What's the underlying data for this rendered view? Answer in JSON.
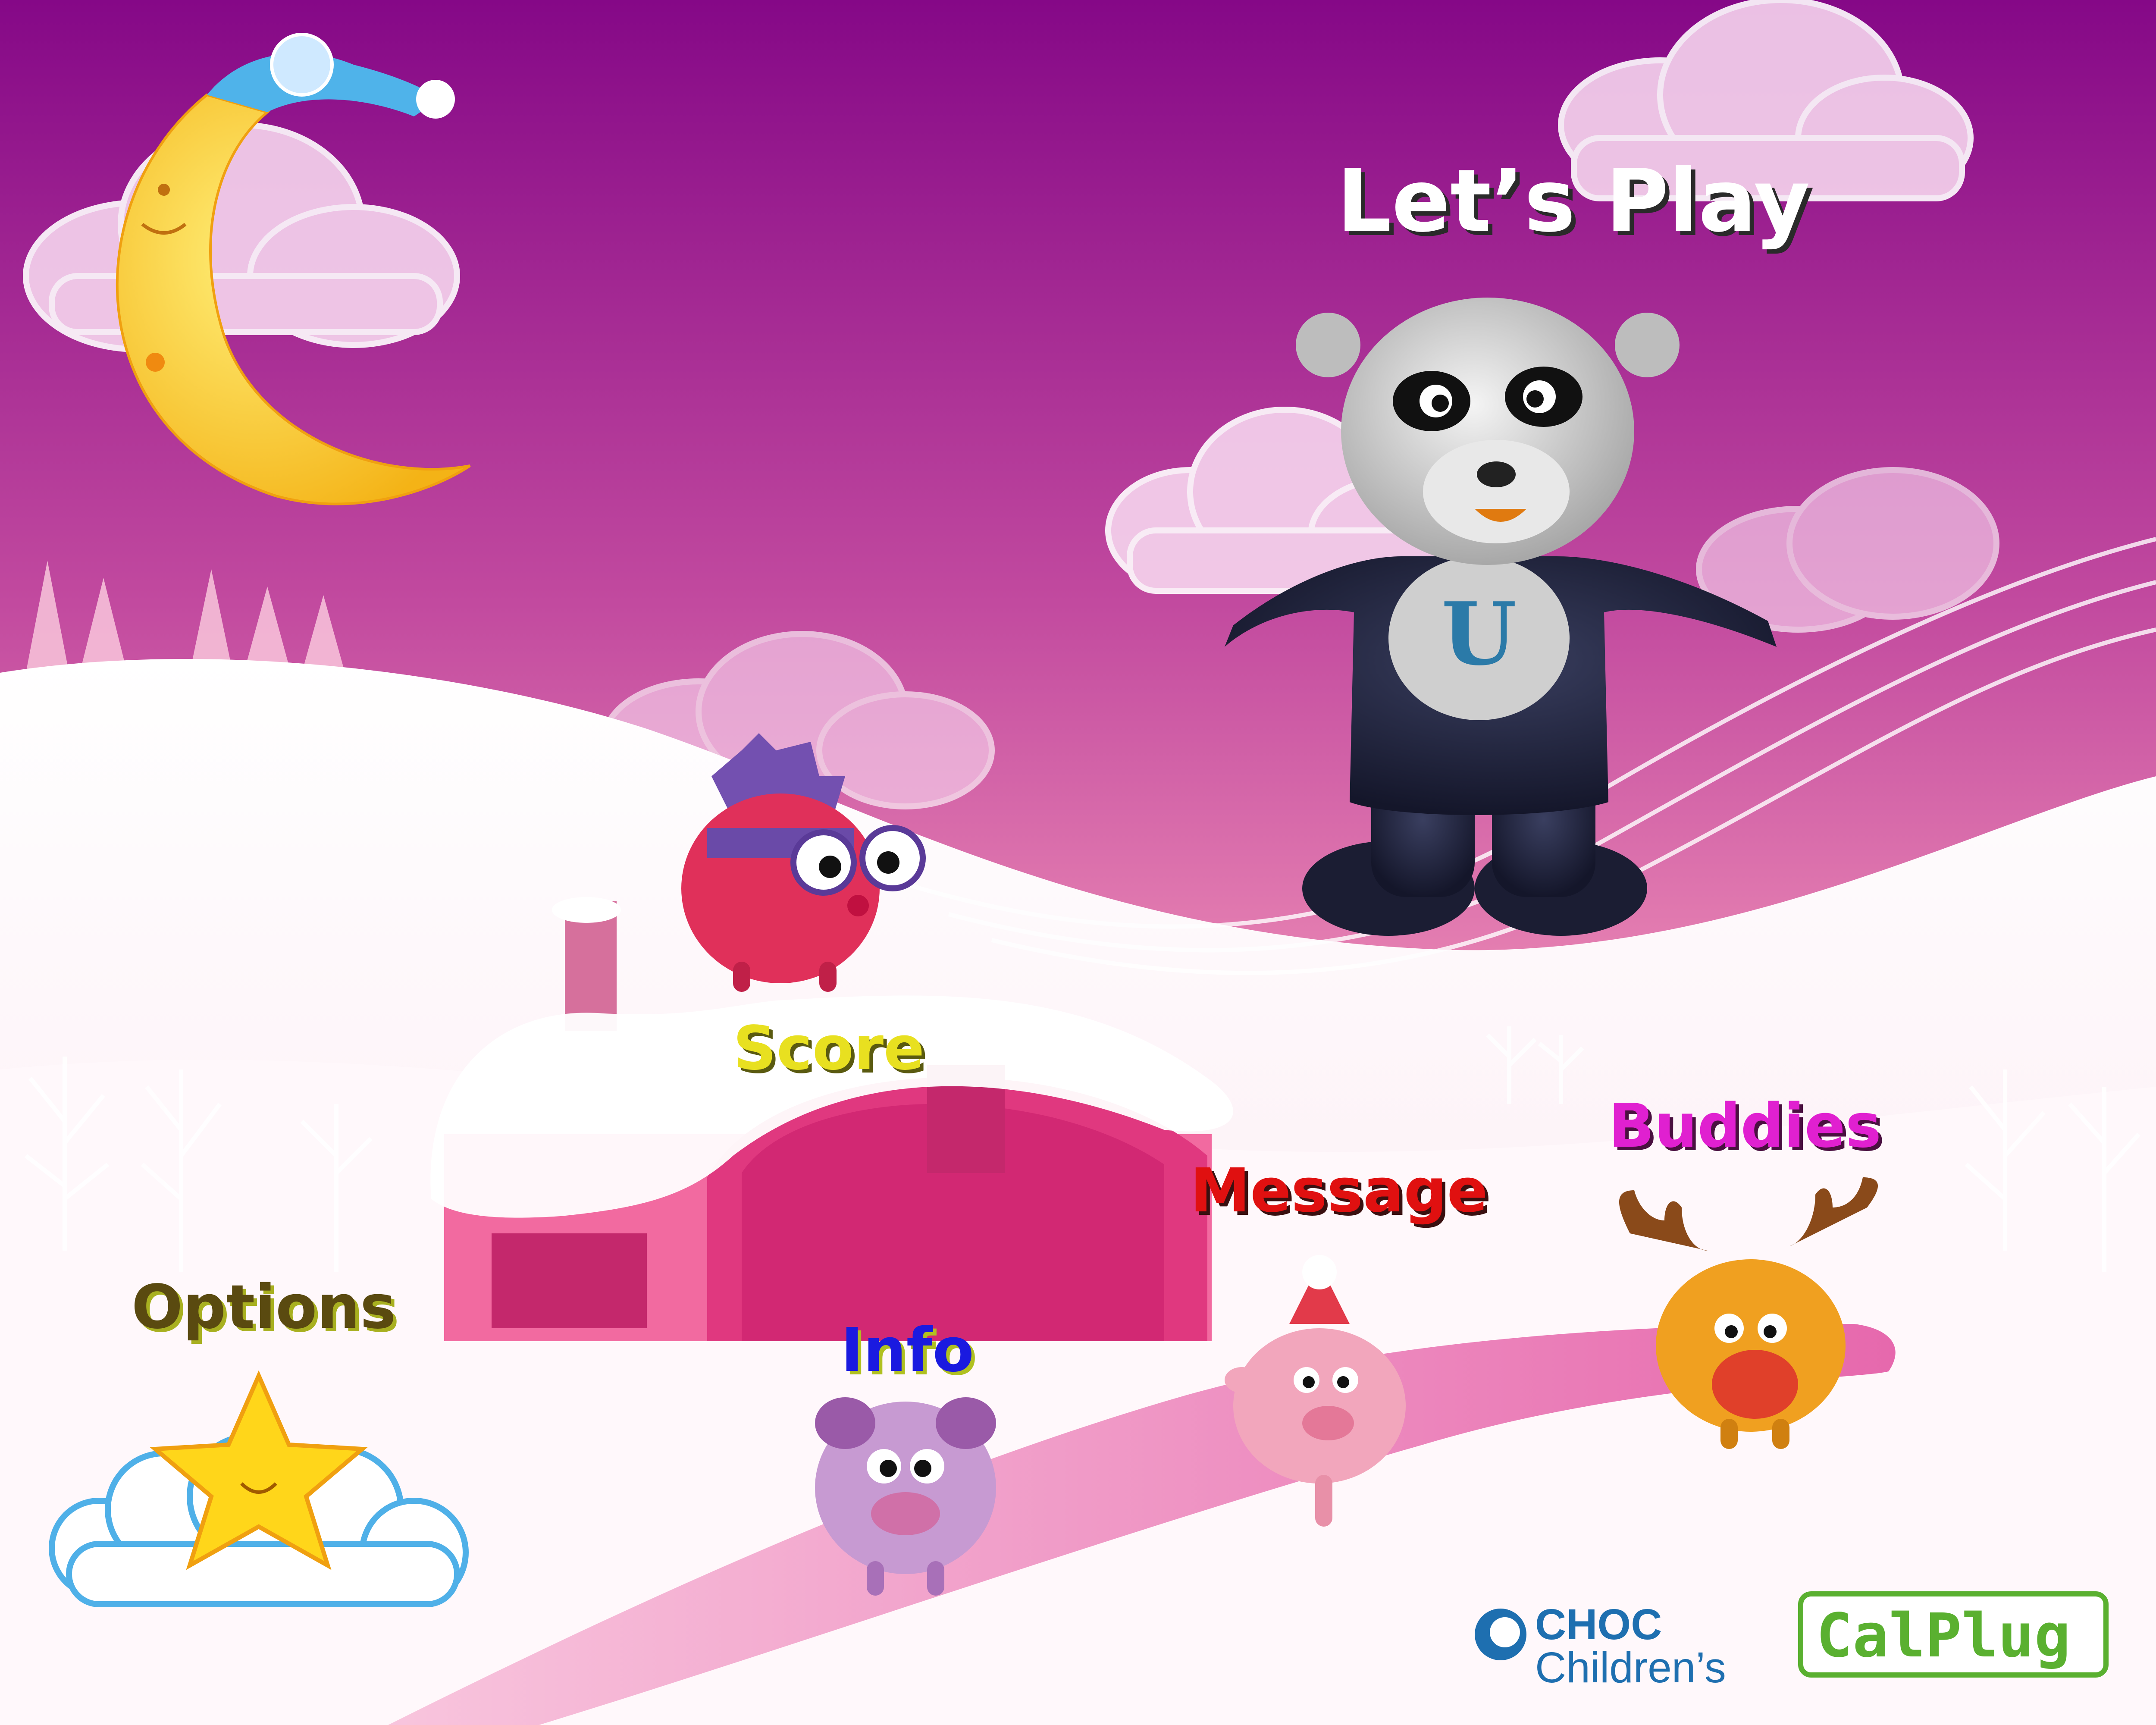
{
  "menu": {
    "lets_play": "Let’s Play",
    "score": "Score",
    "message": "Message",
    "buddies": "Buddies",
    "options": "Options",
    "info": "Info"
  },
  "logos": {
    "choc_top": "CHOC",
    "choc_bottom": "Children’s",
    "calplug": "CalPlug"
  },
  "colors": {
    "sky_top": "#860a8a",
    "sky_bottom": "#f2a0c4",
    "snow": "#fff7fb",
    "lets_play": "#ffffff",
    "score": "#e8e020",
    "message": "#e01010",
    "buddies": "#e020d0",
    "options": "#5a4a10",
    "info": "#1a1ae0",
    "calplug": "#5ab030",
    "choc": "#1e6fb0"
  },
  "icons": {
    "moon": "moon-with-nightcap-icon",
    "star": "star-on-cloud-icon",
    "bear": "panda-bear-mascot",
    "hedgehog": "hedgehog-plush",
    "sheep": "sheep-plush",
    "pig": "pig-plush",
    "moose": "moose-plush"
  }
}
